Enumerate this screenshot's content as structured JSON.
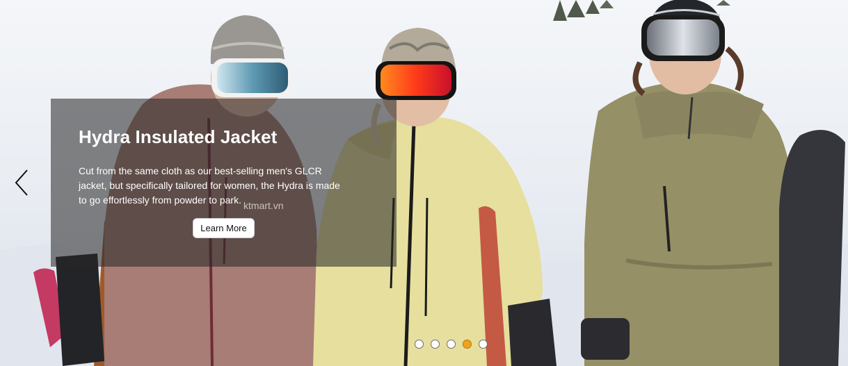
{
  "slide": {
    "title": "Hydra Insulated Jacket",
    "description": "Cut from the same cloth as our best-selling men's GLCR jacket, but specifically tailored for women, the Hydra is made to go effortlessly from powder to park.",
    "cta_label": "Learn More",
    "watermark": "ktmart.vn"
  },
  "navigation": {
    "prev_icon": "chevron-left-icon",
    "dot_count": 5,
    "active_dot": 4
  },
  "colors": {
    "overlay": "rgba(40,40,40,0.56)",
    "active_dot": "#f0a31b",
    "jacket_left": "#a77d75",
    "jacket_middle": "#e6df9e",
    "jacket_right": "#959066"
  }
}
